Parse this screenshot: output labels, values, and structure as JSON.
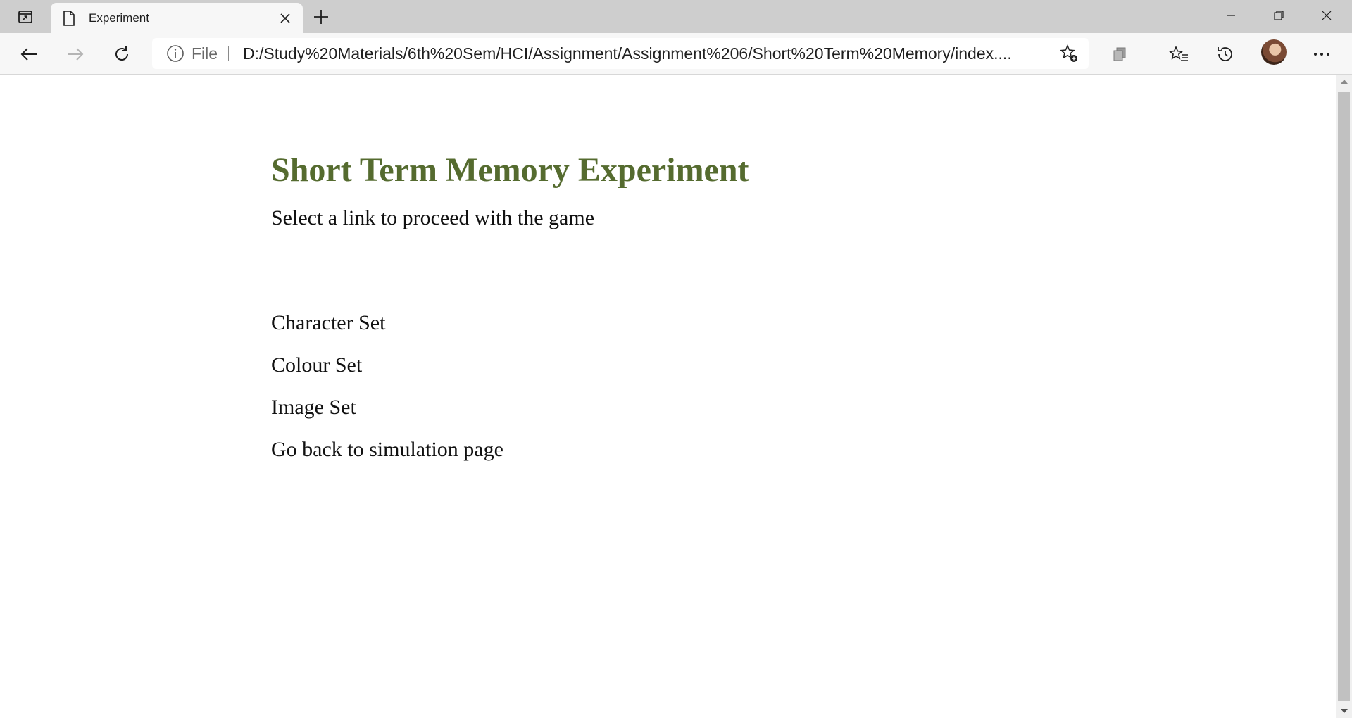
{
  "browser": {
    "tab": {
      "title": "Experiment",
      "icon": "page-icon",
      "close_icon": "close-icon"
    },
    "new_tab_icon": "plus-icon",
    "tab_actions_icon": "tab-actions-icon",
    "window_controls": [
      "minimize-icon",
      "restore-icon",
      "close-icon"
    ],
    "toolbar": {
      "back_icon": "back-arrow-icon",
      "forward_icon": "forward-arrow-icon",
      "refresh_icon": "refresh-icon",
      "address": {
        "scheme_label": "File",
        "url": "D:/Study%20Materials/6th%20Sem/HCI/Assignment/Assignment%206/Short%20Term%20Memory/index...."
      },
      "right_icons": [
        "add-favorite-icon",
        "collections-icon",
        "favorites-icon",
        "history-icon",
        "profile-avatar",
        "more-icon"
      ]
    }
  },
  "page": {
    "title": "Short Term Memory Experiment",
    "subtitle": "Select a link to proceed with the game",
    "links": [
      "Character Set",
      "Colour Set",
      "Image Set",
      "Go back to simulation page"
    ]
  },
  "colors": {
    "title": "#556b2f",
    "text": "#111111",
    "tabstrip": "#cecece",
    "toolbar": "#f7f7f7"
  }
}
